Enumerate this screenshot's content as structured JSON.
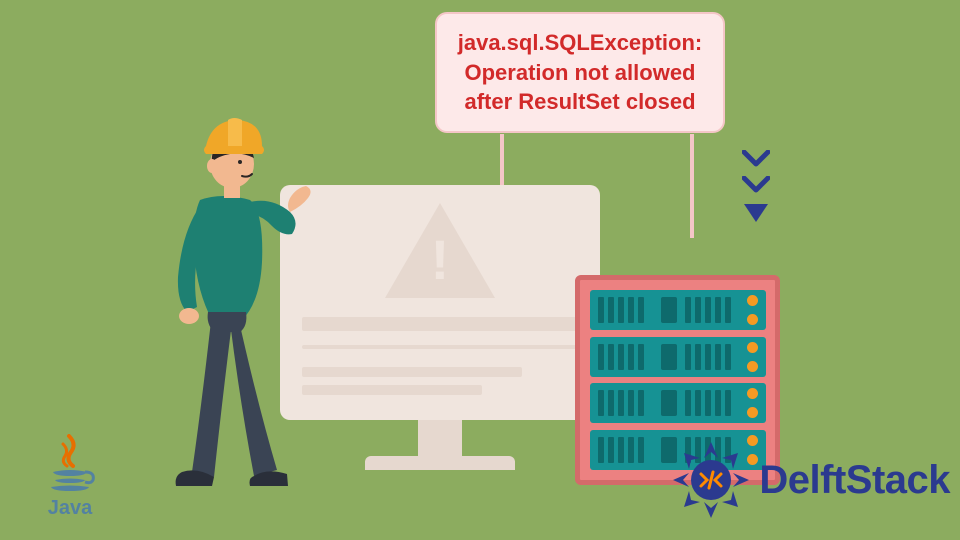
{
  "bubble": {
    "line1": "java.sql.SQLException:",
    "line2": "Operation not allowed",
    "line3": "after ResultSet closed"
  },
  "icons": {
    "warning_mark": "!"
  },
  "logos": {
    "java_label": "Java",
    "delftstack_label": "DelftStack"
  },
  "colors": {
    "background": "#8cac5f",
    "bubble_bg": "#fde9e9",
    "bubble_text": "#d22a2a",
    "server_frame": "#ec8181",
    "server_unit": "#169294",
    "monitor": "#f0e5de",
    "brand_blue": "#2b3a8f",
    "java_blue": "#5382a1"
  }
}
